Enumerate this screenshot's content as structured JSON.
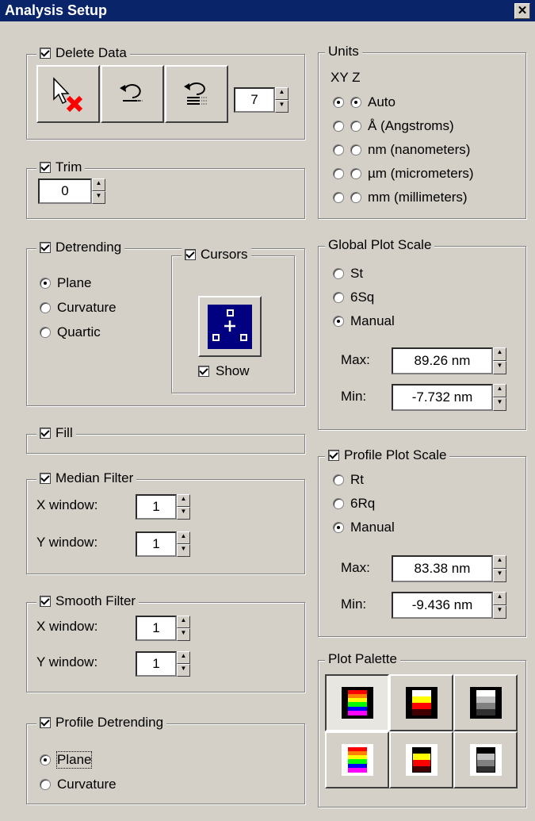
{
  "window": {
    "title": "Analysis Setup",
    "close_glyph": "✕"
  },
  "delete_data": {
    "label": "Delete Data",
    "checked": true,
    "spin_value": "7",
    "buttons": [
      "delete-pointer-icon",
      "undo-icon",
      "undo-all-icon"
    ]
  },
  "trim": {
    "label": "Trim",
    "checked": true,
    "value": "0"
  },
  "detrending": {
    "label": "Detrending",
    "checked": true,
    "options": [
      {
        "label": "Plane",
        "selected": true
      },
      {
        "label": "Curvature",
        "selected": false
      },
      {
        "label": "Quartic",
        "selected": false
      }
    ],
    "cursors": {
      "label": "Cursors",
      "checked": true,
      "show_label": "Show",
      "show_checked": true
    }
  },
  "fill": {
    "label": "Fill",
    "checked": true
  },
  "median_filter": {
    "label": "Median Filter",
    "checked": true,
    "x_label": "X window:",
    "x_value": "1",
    "y_label": "Y window:",
    "y_value": "1"
  },
  "smooth_filter": {
    "label": "Smooth Filter",
    "checked": true,
    "x_label": "X window:",
    "x_value": "1",
    "y_label": "Y window:",
    "y_value": "1"
  },
  "profile_detrending": {
    "label": "Profile Detrending",
    "checked": true,
    "options": [
      {
        "label": "Plane",
        "selected": true
      },
      {
        "label": "Curvature",
        "selected": false
      }
    ]
  },
  "units": {
    "label": "Units",
    "header": "XY Z",
    "options": [
      {
        "label": "Auto",
        "xy": true,
        "z": true
      },
      {
        "label": "Å (Angstroms)",
        "xy": false,
        "z": false
      },
      {
        "label": "nm (nanometers)",
        "xy": false,
        "z": false
      },
      {
        "label": "µm (micrometers)",
        "xy": false,
        "z": false
      },
      {
        "label": "mm (millimeters)",
        "xy": false,
        "z": false
      }
    ]
  },
  "global_plot_scale": {
    "label": "Global Plot Scale",
    "options": [
      {
        "label": "St",
        "selected": false
      },
      {
        "label": "6Sq",
        "selected": false
      },
      {
        "label": "Manual",
        "selected": true
      }
    ],
    "max_label": "Max:",
    "max_value": "89.26 nm",
    "min_label": "Min:",
    "min_value": "-7.732 nm"
  },
  "profile_plot_scale": {
    "label": "Profile Plot Scale",
    "checked": true,
    "options": [
      {
        "label": "Rt",
        "selected": false
      },
      {
        "label": "6Rq",
        "selected": false
      },
      {
        "label": "Manual",
        "selected": true
      }
    ],
    "max_label": "Max:",
    "max_value": "83.38 nm",
    "min_label": "Min:",
    "min_value": "-9.436 nm"
  },
  "plot_palette": {
    "label": "Plot Palette",
    "swatches": [
      {
        "name": "rainbow-dark",
        "selected": true
      },
      {
        "name": "heat-dark",
        "selected": false
      },
      {
        "name": "gray-dark",
        "selected": false
      },
      {
        "name": "rainbow-light",
        "selected": false
      },
      {
        "name": "heat-light",
        "selected": false
      },
      {
        "name": "gray-light",
        "selected": false
      }
    ]
  },
  "colors": {
    "titlebar": "#0a246a",
    "face": "#d4d0c8",
    "delete_x": "#ff0000",
    "cursor_button": "#000080"
  }
}
